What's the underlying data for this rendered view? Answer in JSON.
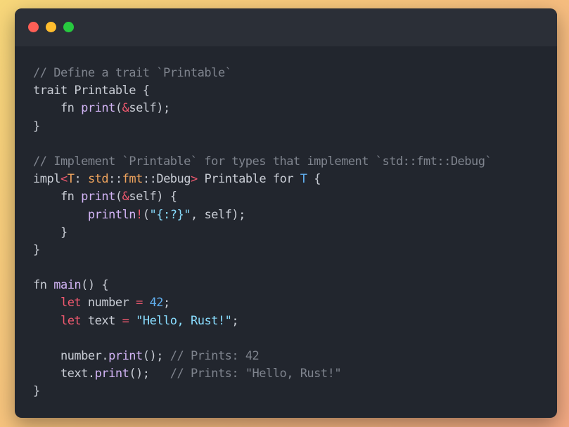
{
  "window": {
    "controls": [
      "close",
      "minimize",
      "maximize"
    ]
  },
  "colors": {
    "comment": "#7f848e",
    "plain": "#c8ccd4",
    "function": "#d2b4f5",
    "keyword": "#ef596f",
    "type": "#e5c07b",
    "string": "#89ddff",
    "number": "#61afef",
    "background": "#22262e"
  },
  "code": {
    "lines": [
      [
        {
          "t": "// Define a trait `Printable`",
          "c": "comment"
        }
      ],
      [
        {
          "t": "trait Printable {",
          "c": "plain"
        }
      ],
      [
        {
          "t": "    fn ",
          "c": "plain"
        },
        {
          "t": "print",
          "c": "fn"
        },
        {
          "t": "(",
          "c": "plain"
        },
        {
          "t": "&",
          "c": "amp"
        },
        {
          "t": "self);",
          "c": "plain"
        }
      ],
      [
        {
          "t": "}",
          "c": "plain"
        }
      ],
      [],
      [
        {
          "t": "// Implement `Printable` for types that implement `std::fmt::Debug`",
          "c": "comment"
        }
      ],
      [
        {
          "t": "impl",
          "c": "plain"
        },
        {
          "t": "<",
          "c": "op"
        },
        {
          "t": "T",
          "c": "typealt"
        },
        {
          "t": ": ",
          "c": "plain"
        },
        {
          "t": "std",
          "c": "typealt"
        },
        {
          "t": "::",
          "c": "plain"
        },
        {
          "t": "fmt",
          "c": "typealt"
        },
        {
          "t": "::Debug",
          "c": "plain"
        },
        {
          "t": ">",
          "c": "op"
        },
        {
          "t": " Printable for ",
          "c": "plain"
        },
        {
          "t": "T",
          "c": "blue"
        },
        {
          "t": " {",
          "c": "plain"
        }
      ],
      [
        {
          "t": "    fn ",
          "c": "plain"
        },
        {
          "t": "print",
          "c": "fn"
        },
        {
          "t": "(",
          "c": "plain"
        },
        {
          "t": "&",
          "c": "amp"
        },
        {
          "t": "self) {",
          "c": "plain"
        }
      ],
      [
        {
          "t": "        ",
          "c": "plain"
        },
        {
          "t": "println",
          "c": "macro"
        },
        {
          "t": "!",
          "c": "op"
        },
        {
          "t": "(",
          "c": "plain"
        },
        {
          "t": "\"{:?}\"",
          "c": "str"
        },
        {
          "t": ", self);",
          "c": "plain"
        }
      ],
      [
        {
          "t": "    }",
          "c": "plain"
        }
      ],
      [
        {
          "t": "}",
          "c": "plain"
        }
      ],
      [],
      [
        {
          "t": "fn ",
          "c": "plain"
        },
        {
          "t": "main",
          "c": "fn"
        },
        {
          "t": "() {",
          "c": "plain"
        }
      ],
      [
        {
          "t": "    ",
          "c": "plain"
        },
        {
          "t": "let",
          "c": "kw"
        },
        {
          "t": " number ",
          "c": "plain"
        },
        {
          "t": "=",
          "c": "op"
        },
        {
          "t": " ",
          "c": "plain"
        },
        {
          "t": "42",
          "c": "num"
        },
        {
          "t": ";",
          "c": "plain"
        }
      ],
      [
        {
          "t": "    ",
          "c": "plain"
        },
        {
          "t": "let",
          "c": "kw"
        },
        {
          "t": " text ",
          "c": "plain"
        },
        {
          "t": "=",
          "c": "op"
        },
        {
          "t": " ",
          "c": "plain"
        },
        {
          "t": "\"Hello, Rust!\"",
          "c": "str"
        },
        {
          "t": ";",
          "c": "plain"
        }
      ],
      [],
      [
        {
          "t": "    number.",
          "c": "plain"
        },
        {
          "t": "print",
          "c": "fn"
        },
        {
          "t": "(); ",
          "c": "plain"
        },
        {
          "t": "// Prints: 42",
          "c": "comment"
        }
      ],
      [
        {
          "t": "    text.",
          "c": "plain"
        },
        {
          "t": "print",
          "c": "fn"
        },
        {
          "t": "();   ",
          "c": "plain"
        },
        {
          "t": "// Prints: \"Hello, Rust!\"",
          "c": "comment"
        }
      ],
      [
        {
          "t": "}",
          "c": "plain"
        }
      ]
    ]
  }
}
